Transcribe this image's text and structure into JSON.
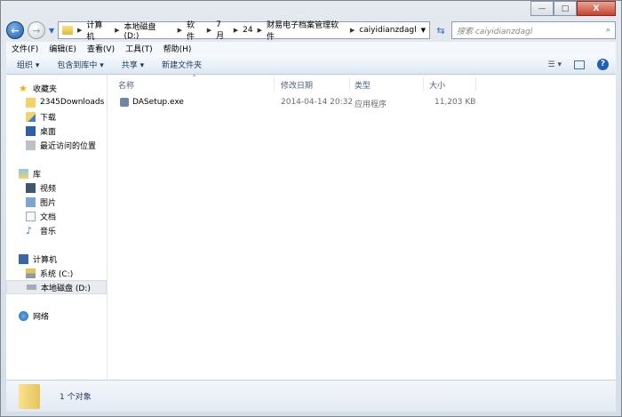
{
  "window": {
    "minimize": "—",
    "maximize": "□",
    "close": "X"
  },
  "address": {
    "crumbs": [
      "计算机",
      "本地磁盘 (D:)",
      "软件",
      "7月",
      "24",
      "财易电子档案管理软件",
      "caiyidianzdagl"
    ],
    "search_placeholder": "搜索 caiyidianzdagl"
  },
  "menu": [
    "文件(F)",
    "编辑(E)",
    "查看(V)",
    "工具(T)",
    "帮助(H)"
  ],
  "toolbar": {
    "organize": "组织 ▾",
    "include": "包含到库中 ▾",
    "share": "共享 ▾",
    "new_folder": "新建文件夹"
  },
  "sidebar": {
    "favorites": {
      "label": "收藏夹",
      "items": [
        "2345Downloads",
        "下载",
        "桌面",
        "最近访问的位置"
      ]
    },
    "libraries": {
      "label": "库",
      "items": [
        "视频",
        "图片",
        "文档",
        "音乐"
      ]
    },
    "computer": {
      "label": "计算机",
      "items": [
        "系统 (C:)",
        "本地磁盘 (D:)"
      ]
    },
    "network": {
      "label": "网络"
    }
  },
  "columns": [
    "名称",
    "修改日期",
    "类型",
    "大小"
  ],
  "files": [
    {
      "name": "DASetup.exe",
      "modified": "2014-04-14 20:32",
      "type": "应用程序",
      "size": "11,203 KB"
    }
  ],
  "status": {
    "count": "1 个对象"
  }
}
